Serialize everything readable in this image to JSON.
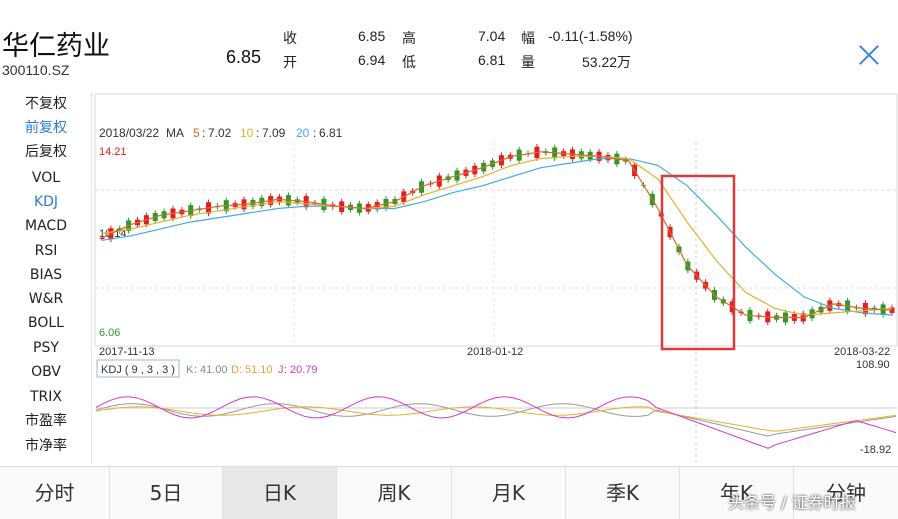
{
  "stock": {
    "name": "华仁药业",
    "code": "300110.SZ",
    "price": "6.85",
    "quote": [
      {
        "label": "收",
        "value": "6.85"
      },
      {
        "label": "开",
        "value": "6.94"
      },
      {
        "label": "高",
        "value": "7.04"
      },
      {
        "label": "低",
        "value": "6.81"
      },
      {
        "label": "幅",
        "value": "-0.11(-1.58%)"
      },
      {
        "label": "量",
        "value": "53.22万"
      }
    ]
  },
  "sidebar": {
    "items": [
      "不复权",
      "前复权",
      "后复权",
      "VOL",
      "KDJ",
      "MACD",
      "RSI",
      "BIAS",
      "W&R",
      "BOLL",
      "PSY",
      "OBV",
      "TRIX",
      "市盈率",
      "市净率"
    ],
    "active": [
      "前复权",
      "KDJ"
    ]
  },
  "chart": {
    "ma_header": {
      "date": "2018/03/22",
      "ma_label": "MA",
      "items": [
        {
          "key": "5",
          "value": "7.02",
          "color": "#e0662a"
        },
        {
          "key": "10",
          "value": "7.09",
          "color": "#e6b02e"
        },
        {
          "key": "20",
          "value": "6.81",
          "color": "#4aa8e6"
        }
      ]
    },
    "y_labels": {
      "top": "14.21",
      "mid": "10.14",
      "bottom": "6.06"
    },
    "x_labels": [
      "2017-11-13",
      "2018-01-12",
      "2018-03-22"
    ],
    "kdj_header": {
      "name": "KDJ ( 9 , 3 , 3 )",
      "items": [
        {
          "key": "K",
          "value": "41.00",
          "color": "#8a8a8a"
        },
        {
          "key": "D",
          "value": "51.10",
          "color": "#e6b02e"
        },
        {
          "key": "J",
          "value": "20.79",
          "color": "#d437d4"
        }
      ]
    },
    "kdj_labels": {
      "top": "108.90",
      "bottom": "-18.92"
    },
    "colors": {
      "up": "#e02020",
      "down": "#2a9a2a",
      "ma5": "#e0662a",
      "ma10": "#e6b02e",
      "ma20": "#4aa8e6",
      "k": "#8a8a8a",
      "d": "#e6b02e",
      "j": "#d437d4",
      "highlight": "#d93a3a"
    }
  },
  "chart_data": {
    "type": "candlestick",
    "x_range": [
      "2017-11-13",
      "2018-03-22"
    ],
    "ylim": [
      6.06,
      14.21
    ],
    "series": [
      {
        "name": "MA5",
        "values": [
          10.2,
          10.8,
          11.2,
          11.4,
          11.6,
          11.7,
          11.9,
          11.8,
          11.6,
          11.5,
          11.8,
          12.5,
          12.9,
          13.3,
          13.8,
          14.0,
          13.9,
          13.8,
          13.6,
          11.5,
          9.0,
          7.6,
          6.8,
          6.7,
          6.7,
          7.3,
          7.1,
          7.02
        ]
      },
      {
        "name": "MA10",
        "values": [
          10.4,
          10.6,
          10.9,
          11.2,
          11.4,
          11.6,
          11.8,
          11.7,
          11.6,
          11.5,
          11.6,
          12.1,
          12.5,
          12.9,
          13.4,
          13.7,
          13.8,
          13.8,
          13.7,
          12.8,
          10.9,
          9.2,
          7.8,
          7.1,
          6.8,
          6.9,
          7.0,
          7.09
        ]
      },
      {
        "name": "MA20",
        "values": [
          10.1,
          10.3,
          10.6,
          10.9,
          11.1,
          11.3,
          11.5,
          11.6,
          11.6,
          11.5,
          11.5,
          11.8,
          12.2,
          12.5,
          12.9,
          13.3,
          13.5,
          13.7,
          13.7,
          13.4,
          12.5,
          11.2,
          9.8,
          8.6,
          7.6,
          7.1,
          6.9,
          6.81
        ]
      }
    ],
    "kdj": {
      "ylim": [
        -18.92,
        108.9
      ],
      "K": 41.0,
      "D": 51.1,
      "J": 20.79
    }
  }
}
